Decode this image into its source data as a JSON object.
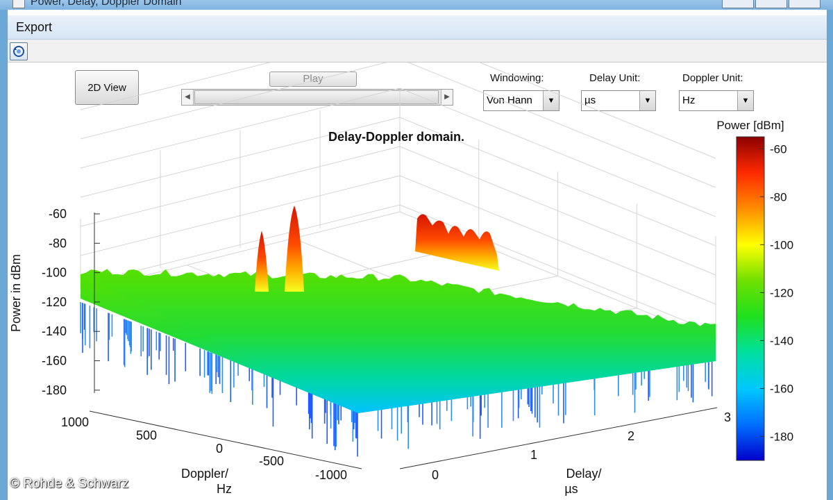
{
  "window": {
    "title": "Power, Delay, Doppler Domain"
  },
  "menu": {
    "items": [
      "Export"
    ]
  },
  "toolbar": {
    "icons": [
      "rotate-3d-icon"
    ]
  },
  "controls": {
    "view_button": "2D View",
    "play_button": "Play",
    "windowing": {
      "label": "Windowing:",
      "value": "Von Hann"
    },
    "delay_unit": {
      "label": "Delay Unit:",
      "value": "µs"
    },
    "doppler_unit": {
      "label": "Doppler Unit:",
      "value": "Hz"
    }
  },
  "chart_data": {
    "type": "surface3d",
    "title": "Delay-Doppler domain.",
    "zlabel": "Power in dBm",
    "xlabel": "Doppler/\nHz",
    "ylabel": "Delay/\nµs",
    "x_ticks": [
      "1000",
      "500",
      "0",
      "-500",
      "-1000"
    ],
    "y_ticks": [
      "0",
      "1",
      "2",
      "3"
    ],
    "z_ticks": [
      "-60",
      "-80",
      "-100",
      "-120",
      "-140",
      "-160",
      "-180"
    ],
    "zlim": [
      -180,
      -60
    ],
    "noise_floor_dBm": -120,
    "peaks": [
      {
        "doppler_hz": 900,
        "delay_us": 0.5,
        "power_dbm": -78
      },
      {
        "doppler_hz": 650,
        "delay_us": 0.6,
        "power_dbm": -61
      },
      {
        "doppler_hz": 0,
        "delay_us_range": [
          1.3,
          1.8
        ],
        "power_dbm": -66
      }
    ],
    "colorbar": {
      "label": "Power [dBm]",
      "ticks": [
        "-60",
        "-80",
        "-100",
        "-120",
        "-140",
        "-160",
        "-180"
      ],
      "range": [
        -190,
        -55
      ],
      "colors": [
        "#8b0000",
        "#ff2a00",
        "#ff8c00",
        "#ffff00",
        "#70e000",
        "#1ee01e",
        "#00e0a0",
        "#00c8ff",
        "#0070ff",
        "#0000cc"
      ]
    }
  },
  "footer": {
    "copyright": "© Rohde & Schwarz"
  }
}
